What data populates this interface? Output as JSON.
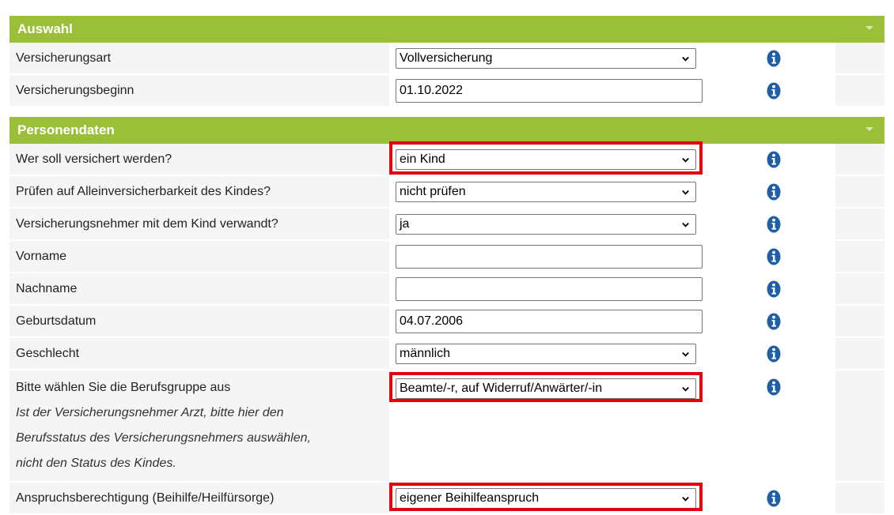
{
  "sections": {
    "auswahl": {
      "title": "Auswahl",
      "rows": {
        "versicherungsart": {
          "label": "Versicherungsart",
          "value": "Vollversicherung"
        },
        "versicherungsbeginn": {
          "label": "Versicherungsbeginn",
          "value": "01.10.2022"
        }
      }
    },
    "personendaten": {
      "title": "Personendaten",
      "rows": {
        "wer": {
          "label": "Wer soll versichert werden?",
          "value": "ein Kind",
          "highlighted": true
        },
        "pruefen": {
          "label": "Prüfen auf Alleinversicherbarkeit des Kindes?",
          "value": "nicht prüfen"
        },
        "verwandt": {
          "label": "Versicherungsnehmer mit dem Kind verwandt?",
          "value": "ja"
        },
        "vorname": {
          "label": "Vorname",
          "value": "",
          "placeholder": ""
        },
        "nachname": {
          "label": "Nachname",
          "value": "",
          "placeholder": ""
        },
        "geburtsdatum": {
          "label": "Geburtsdatum",
          "value": "04.07.2006"
        },
        "geschlecht": {
          "label": "Geschlecht",
          "value": "männlich"
        },
        "berufsgruppe": {
          "label": "Bitte wählen Sie die Berufsgruppe aus",
          "note_lines": [
            "Ist der Versicherungsnehmer Arzt, bitte hier den",
            "Berufsstatus des Versicherungsnehmers auswählen,",
            "nicht den Status des Kindes."
          ],
          "value": "Beamte/-r, auf Widerruf/Anwärter/-in",
          "highlighted": true
        },
        "anspruch": {
          "label": "Anspruchsberechtigung (Beihilfe/Heilfürsorge)",
          "value": "eigener Beihilfeanspruch",
          "highlighted": true
        }
      }
    }
  },
  "colors": {
    "header_green": "#9cbf3a",
    "label_bg": "#f5f5f5",
    "highlight_red": "#e3000f",
    "info_blue": "#1f5fa8"
  },
  "icons": {
    "info": "info-icon",
    "dropdown": "chevron-down-icon",
    "collapse": "caret-down-icon"
  }
}
